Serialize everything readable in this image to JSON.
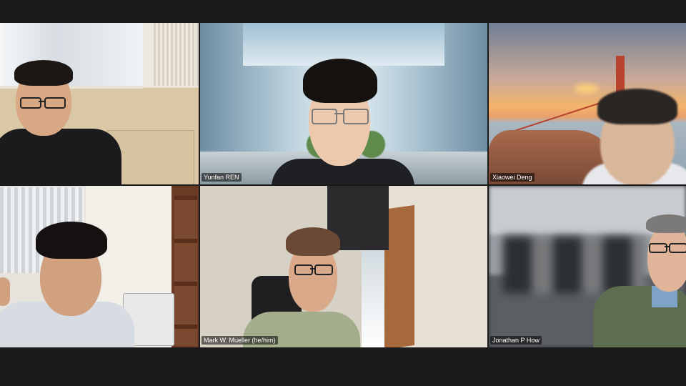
{
  "meeting": {
    "participants": [
      {
        "name": "",
        "active_speaker": false
      },
      {
        "name": "Yunfan REN",
        "active_speaker": false
      },
      {
        "name": "Xiaowei Deng",
        "active_speaker": false
      },
      {
        "name": "",
        "active_speaker": true
      },
      {
        "name": "Mark W. Mueller (he/him)",
        "active_speaker": false
      },
      {
        "name": "Jonathan P How",
        "active_speaker": false
      }
    ]
  },
  "colors": {
    "background": "#1a1a1a",
    "active_speaker_border": "#2ecc40"
  }
}
